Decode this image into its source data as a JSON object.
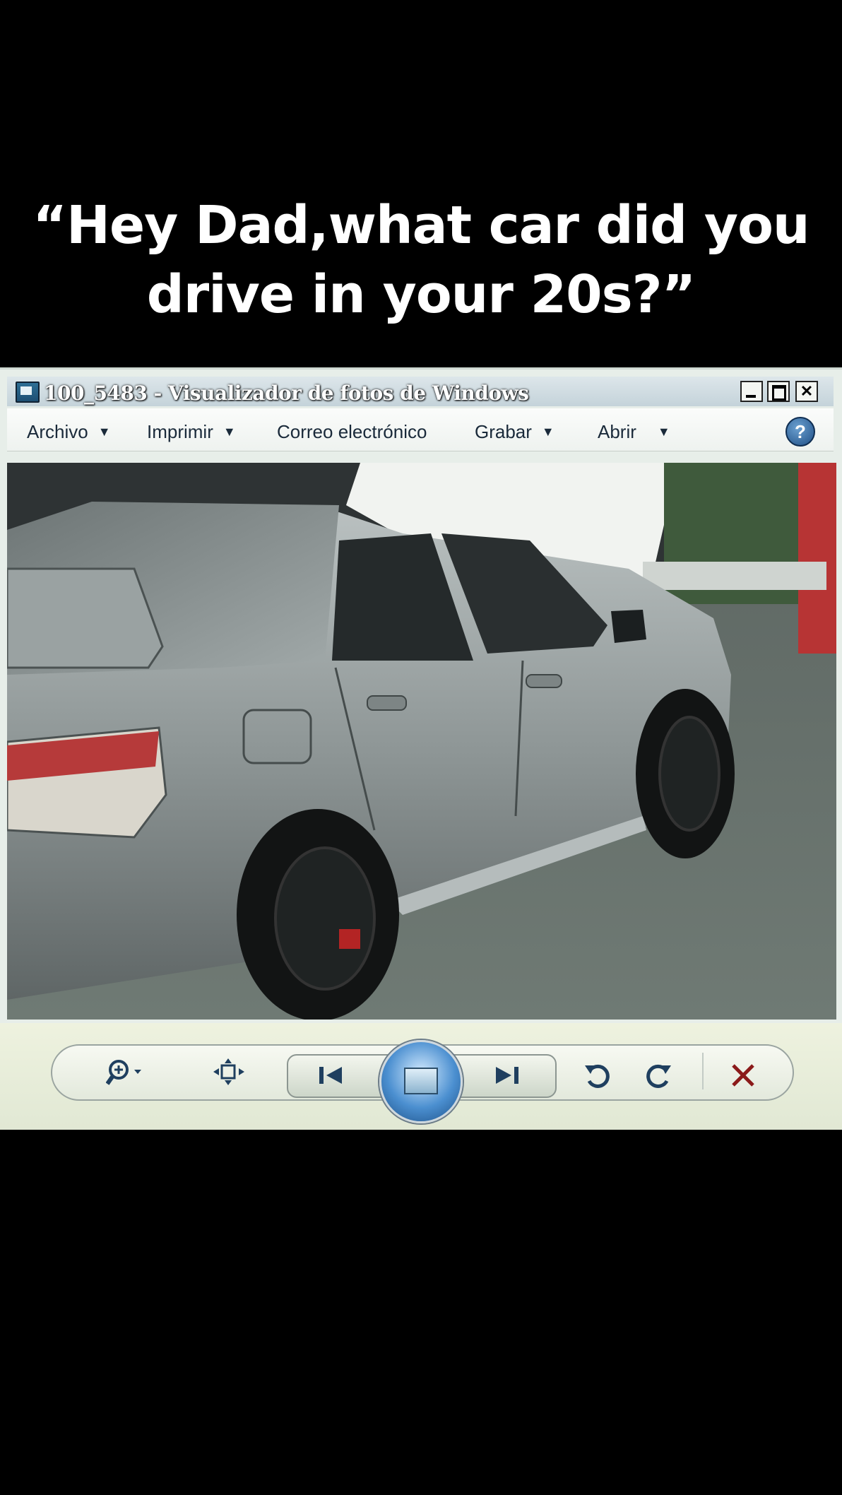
{
  "caption": {
    "line1": "“Hey Dad,what car did you",
    "line2": "drive in your 20s?”"
  },
  "window": {
    "title": "100_5483 - Visualizador de fotos de Windows",
    "controls": {
      "minimize": "_",
      "maximize": "□",
      "close": "✕"
    }
  },
  "menu": {
    "items": [
      {
        "label": "Archivo",
        "has_dropdown": true
      },
      {
        "label": "Imprimir",
        "has_dropdown": true
      },
      {
        "label": "Correo electrónico",
        "has_dropdown": false
      },
      {
        "label": "Grabar",
        "has_dropdown": true
      },
      {
        "label": "Abrir",
        "has_dropdown": true
      }
    ],
    "help": "?"
  },
  "toolbar": {
    "zoom_icon": "zoom-icon",
    "fit_icon": "fit-to-window-icon",
    "prev_icon": "previous-icon",
    "slideshow_icon": "slideshow-icon",
    "next_icon": "next-icon",
    "rotate_ccw_icon": "rotate-counterclockwise-icon",
    "rotate_cw_icon": "rotate-clockwise-icon",
    "delete_icon": "delete-icon",
    "delete_color": "#8b1a1a"
  },
  "photo": {
    "subject": "silver sedan"
  }
}
